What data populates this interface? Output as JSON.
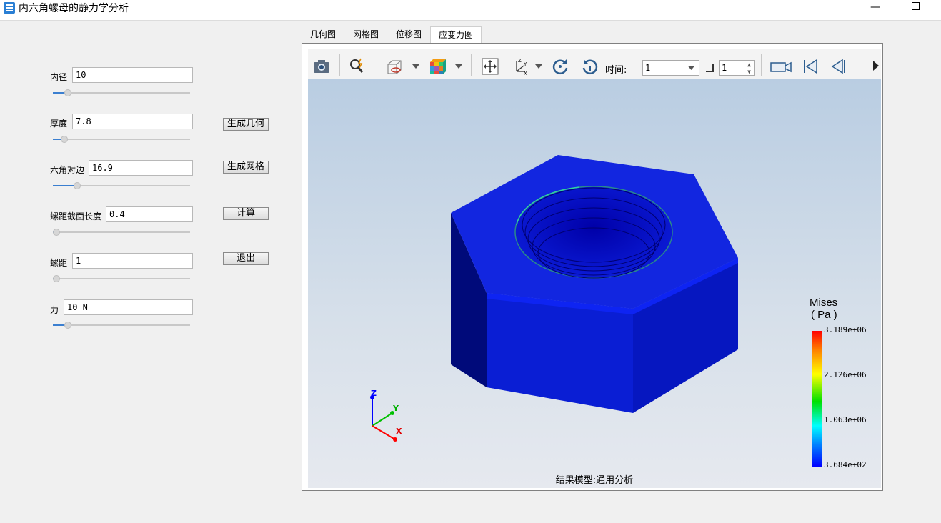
{
  "window": {
    "title": "内六角螺母的静力学分析",
    "minimize_icon": "minimize-icon",
    "maximize_icon": "maximize-icon"
  },
  "params": [
    {
      "label": "内径",
      "value": "10",
      "slider_fraction": 0.09
    },
    {
      "label": "厚度",
      "value": "7.8",
      "slider_fraction": 0.06
    },
    {
      "label": "六角对边",
      "value": "16.9",
      "slider_fraction": 0.16
    },
    {
      "label": "螺距截面长度",
      "value": "0.4",
      "slider_fraction": 0.0
    },
    {
      "label": "螺距",
      "value": "1",
      "slider_fraction": 0.0
    },
    {
      "label": "力",
      "value": "10 N",
      "slider_fraction": 0.09
    }
  ],
  "buttons": {
    "gen_geometry": "生成几何",
    "gen_mesh": "生成网格",
    "compute": "计算",
    "exit": "退出"
  },
  "tabs": [
    "几何图",
    "网格图",
    "位移图",
    "应变力图"
  ],
  "active_tab": "应变力图",
  "toolbar": {
    "time_label": "时间:",
    "time_value": "1",
    "step_value": "1"
  },
  "view": {
    "caption": "结果模型:通用分析",
    "axes": {
      "z": "Z",
      "y": "Y",
      "x": "X"
    },
    "legend": {
      "title_line1": "Mises",
      "title_line2": "( Pa )",
      "ticks": [
        "3.189e+06",
        "2.126e+06",
        "1.063e+06",
        "3.684e+02"
      ]
    }
  }
}
